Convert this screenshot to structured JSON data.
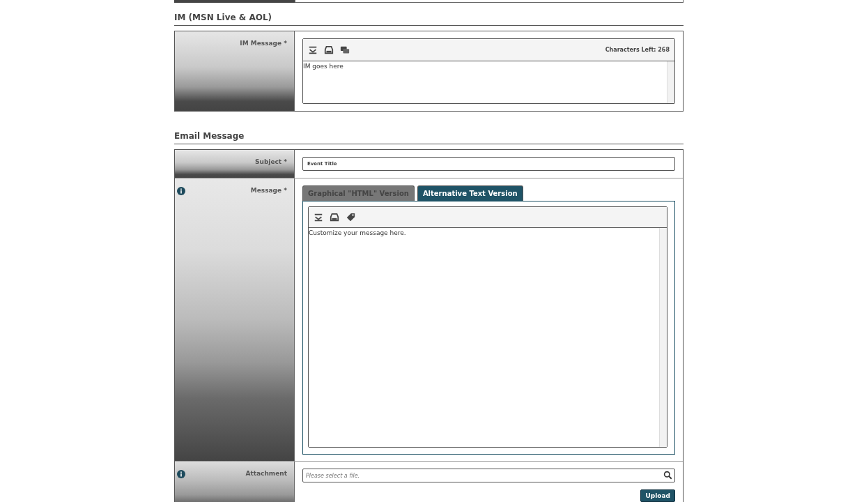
{
  "sections": [
    {
      "heading": "IM (MSN Live & AOL)",
      "rows": [
        {
          "kind": "editor",
          "label": "IM Message *",
          "info": false,
          "counter": "Characters Left: 268",
          "text": "IM goes here"
        }
      ]
    },
    {
      "heading": "Email Message",
      "rows": [
        {
          "kind": "text",
          "label": "Subject *",
          "info": false,
          "value": "Event Title"
        },
        {
          "kind": "tabs",
          "label": "Message *",
          "info": true,
          "tabs": [
            {
              "label": "Graphical \"HTML\" Version",
              "selected": false
            },
            {
              "label": "Alternative Text Version",
              "selected": true
            }
          ],
          "text": "Customize your message here."
        },
        {
          "kind": "file",
          "label": "Attachment",
          "info": true,
          "placeholder": "Please select a file.",
          "button": "Upload"
        }
      ]
    }
  ]
}
